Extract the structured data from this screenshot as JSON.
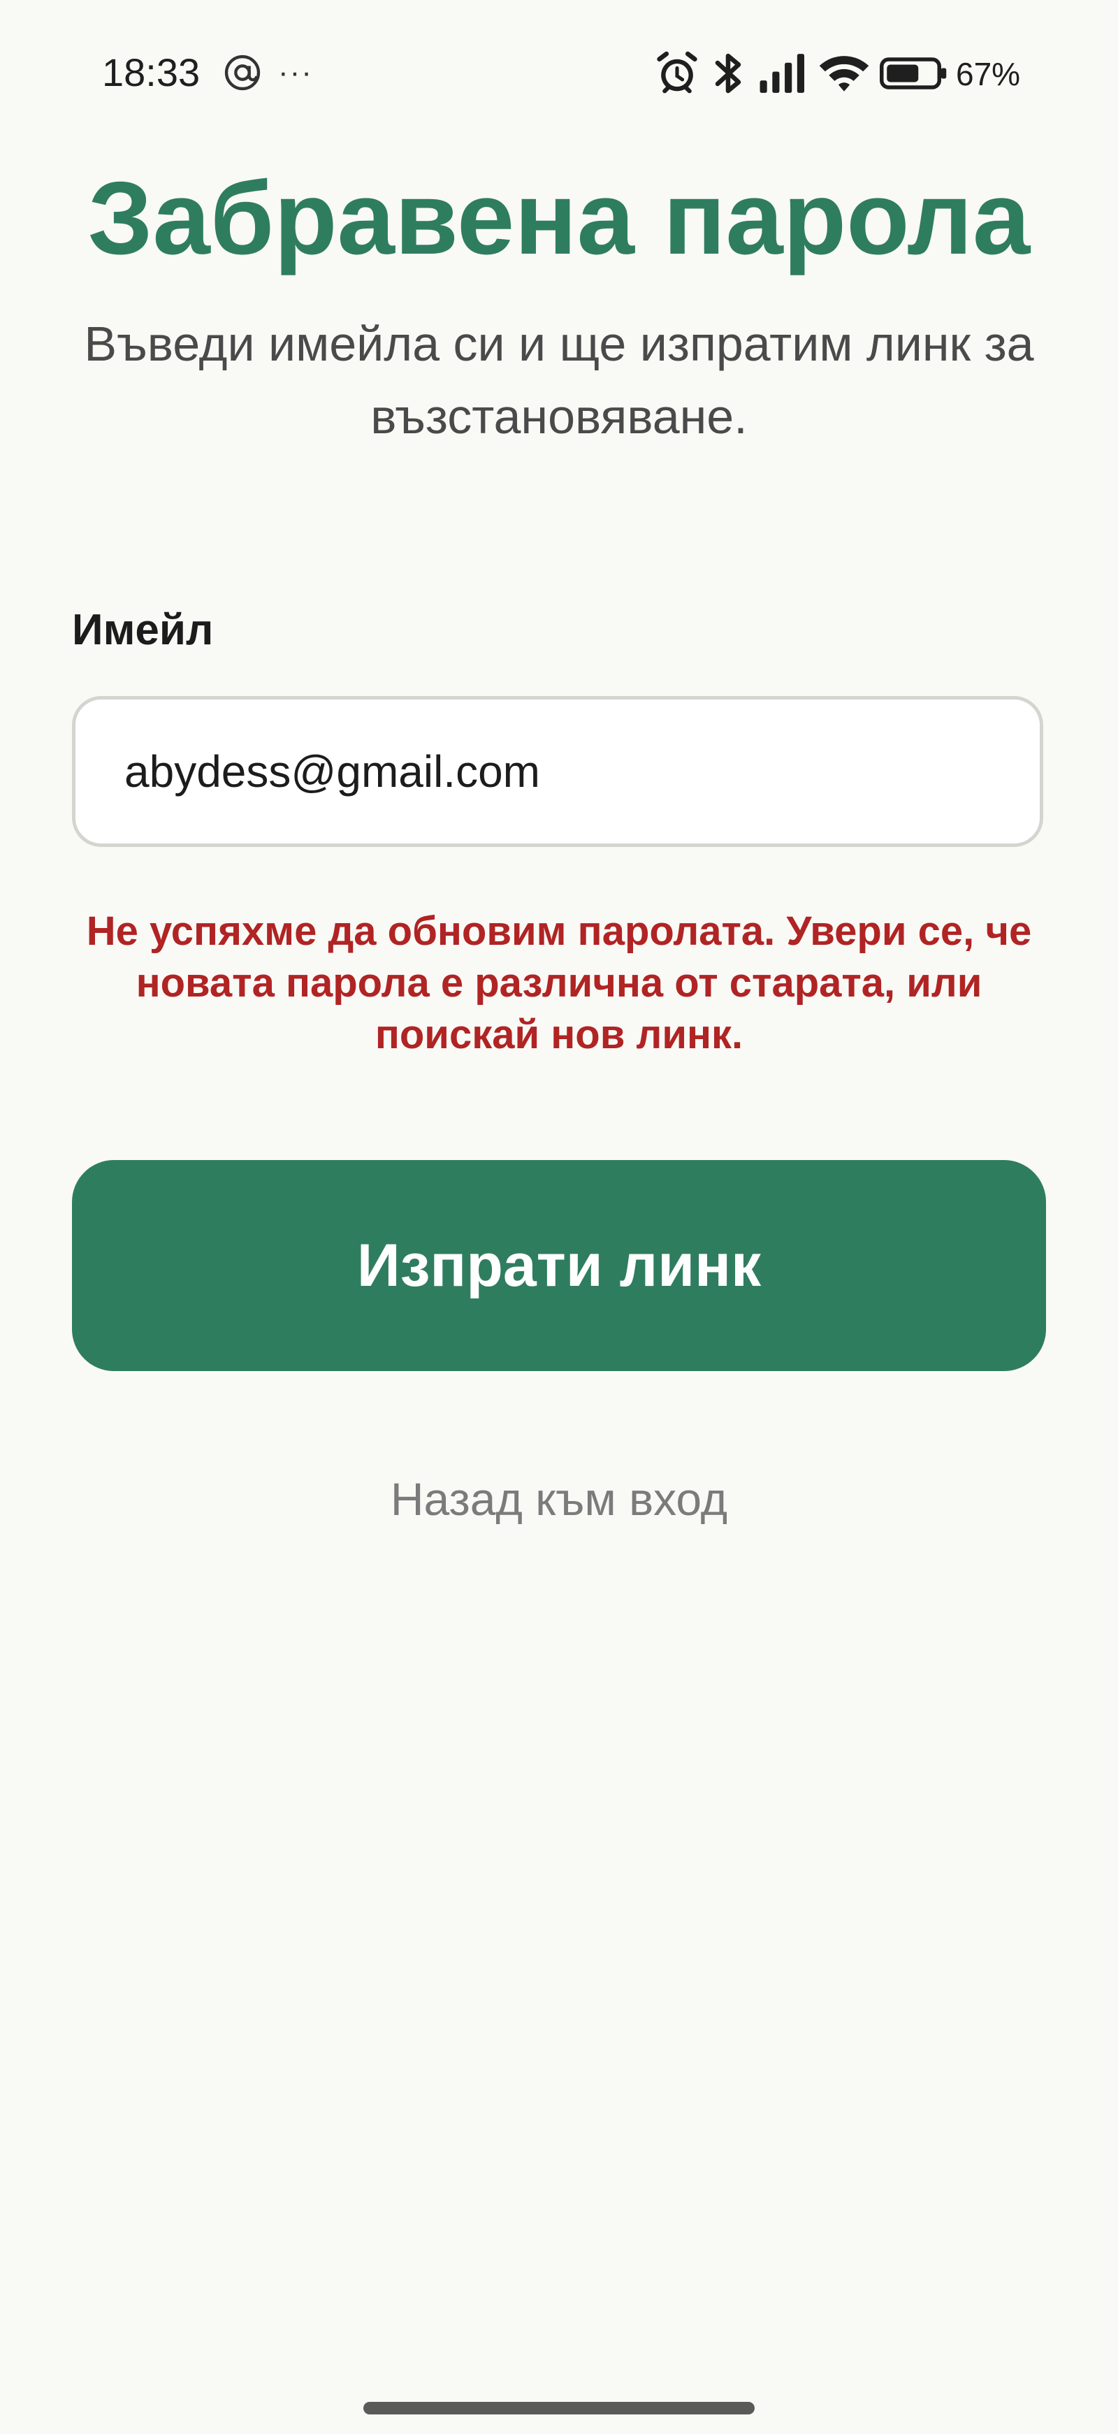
{
  "status_bar": {
    "time": "18:33",
    "overflow": "···",
    "battery_percent": "67%",
    "icons": [
      "at-sign-icon",
      "alarm-icon",
      "bluetooth-icon",
      "signal-icon",
      "wifi-icon",
      "battery-icon"
    ]
  },
  "header": {
    "title": "Забравена парола",
    "subtitle": "Въведи имейла си и ще изпратим линк за възстановяване."
  },
  "form": {
    "email_label": "Имейл",
    "email_value": "abydess@gmail.com",
    "error_message": "Не успяхме да обновим паролата. Увери се, че новата парола е различна от старата, или поискай нов линк.",
    "submit_label": "Изпрати линк"
  },
  "footer": {
    "back_link": "Назад към вход"
  },
  "colors": {
    "brand": "#2f7d5f",
    "error": "#b02424",
    "background": "#f9f9f6"
  }
}
